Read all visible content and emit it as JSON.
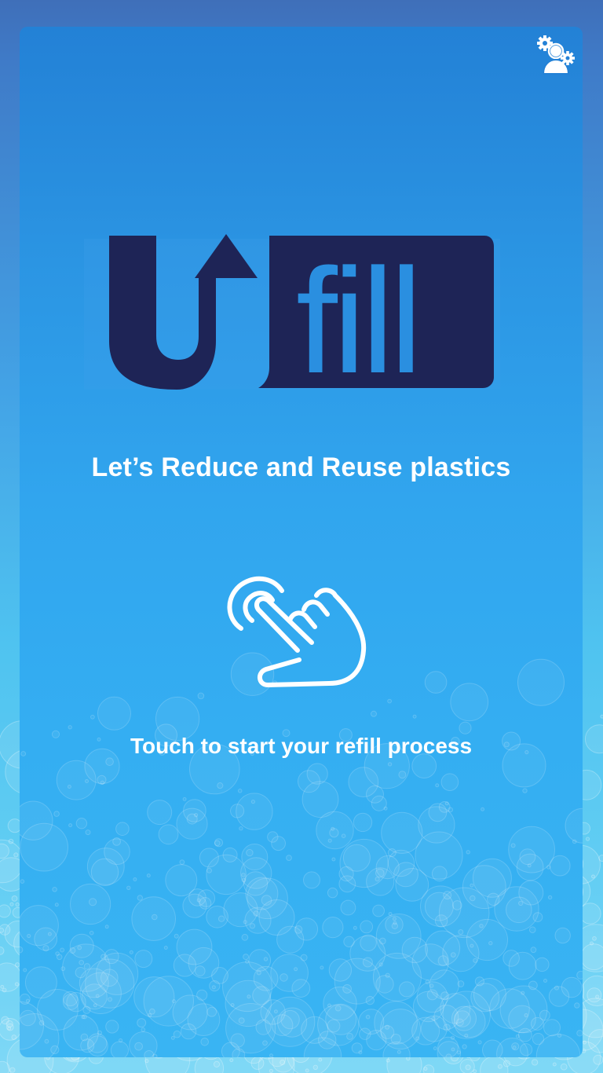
{
  "app": {
    "logo": {
      "prefix": "U",
      "word": "fill",
      "prefix_color": "#1e2456",
      "word_color": "#2a8fe0",
      "box_color": "#1e2456"
    },
    "tagline": "Let’s Reduce and Reuse plastics",
    "touch_prompt": "Touch to start your refill process",
    "icons": {
      "settings": "user-gear-icon",
      "touch": "hand-tap-icon"
    },
    "colors": {
      "panel_top": "#2381d6",
      "panel_bottom": "#39b4f3",
      "text": "#ffffff"
    }
  }
}
